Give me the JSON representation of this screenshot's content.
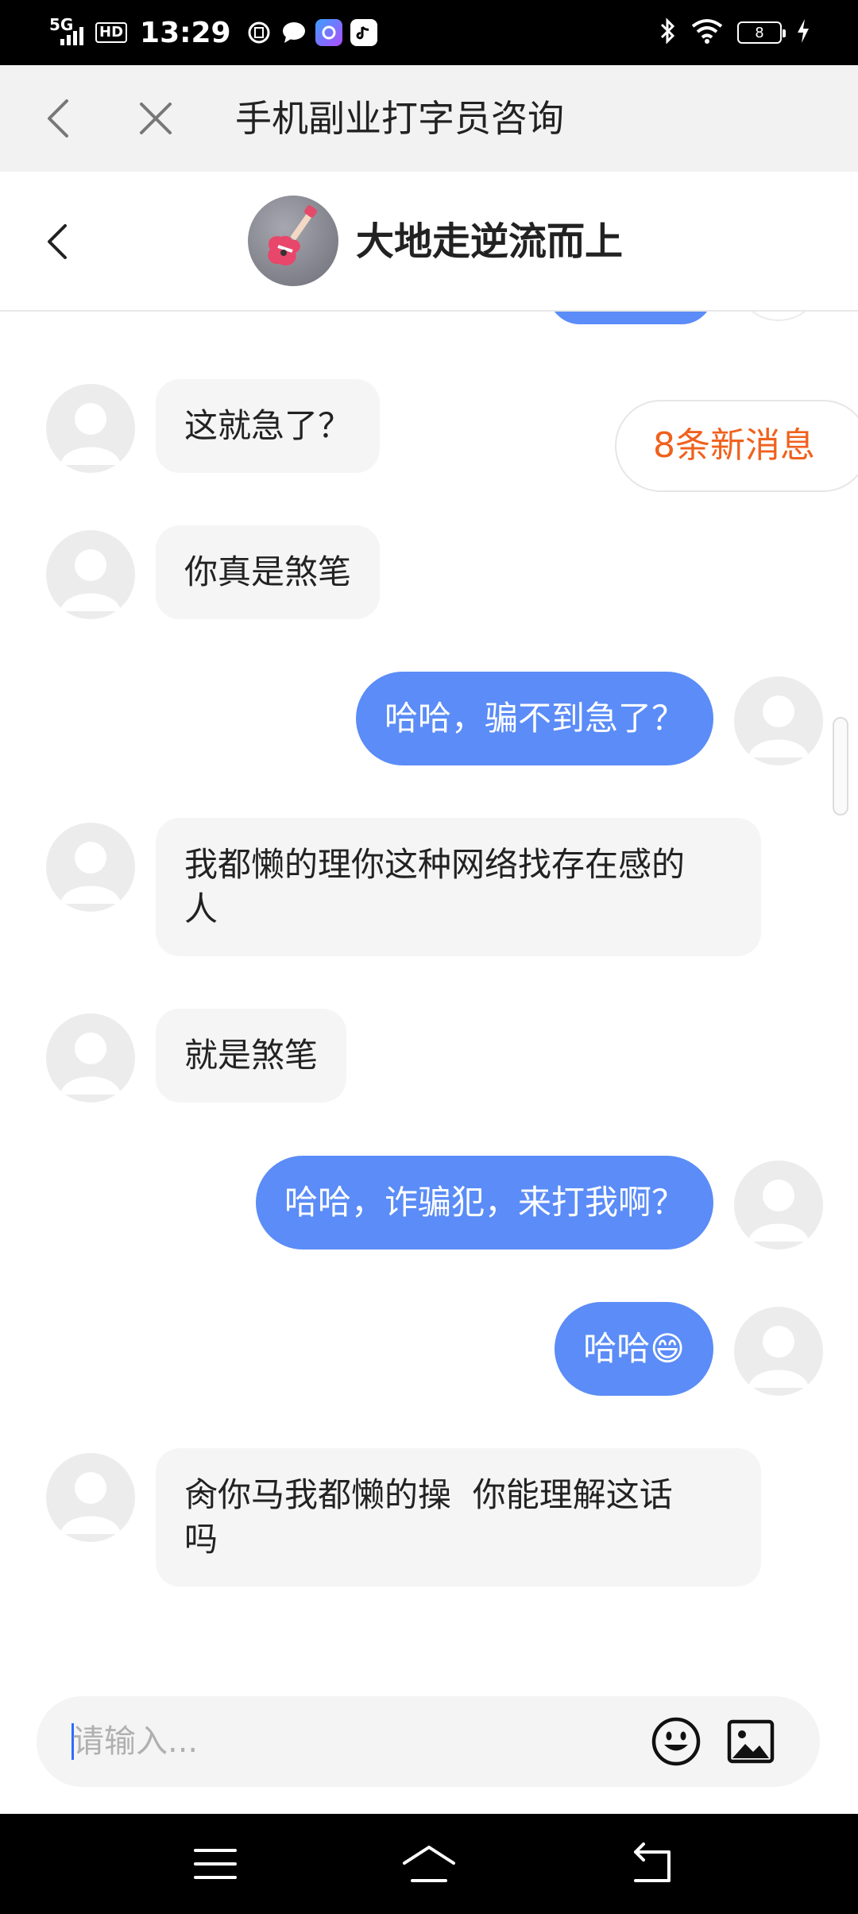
{
  "status_bar": {
    "network": "5G",
    "hd": "HD",
    "time": "13:29",
    "battery": "8"
  },
  "browser": {
    "title": "手机副业打字员咨询"
  },
  "chat": {
    "contact_name": "大地走逆流而上"
  },
  "new_messages_badge": "8条新消息",
  "messages": [
    {
      "side": "in",
      "text": "这就急了？"
    },
    {
      "side": "in",
      "text": "你真是煞笔"
    },
    {
      "side": "out",
      "text": "哈哈，骗不到急了？"
    },
    {
      "side": "in",
      "line1": "我都懒的理你这种网络找存在感的",
      "line2": "人"
    },
    {
      "side": "in",
      "text": "就是煞笔"
    },
    {
      "side": "out",
      "text": "哈哈，诈骗犯，来打我啊？"
    },
    {
      "side": "out",
      "text": "哈哈😄"
    },
    {
      "side": "in",
      "line1": "肏你马我都懒的操  你能理解这话",
      "line2": "吗"
    }
  ],
  "input": {
    "placeholder": "请输入..."
  },
  "colors": {
    "outgoing_bubble": "#5b8cf7",
    "incoming_bubble": "#f5f5f5",
    "badge_text": "#f0611e"
  }
}
